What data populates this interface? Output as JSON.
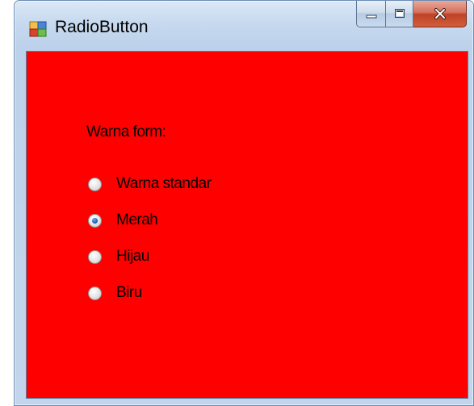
{
  "window": {
    "title": "RadioButton",
    "caption_buttons": {
      "minimize_icon": "minimize-icon",
      "maximize_icon": "maximize-icon",
      "close_icon": "close-icon"
    }
  },
  "form": {
    "background_color": "#ff0000",
    "label": "Warna form:",
    "options": [
      {
        "label": "Warna standar",
        "checked": false
      },
      {
        "label": "Merah",
        "checked": true
      },
      {
        "label": "Hijau",
        "checked": false
      },
      {
        "label": "Biru",
        "checked": false
      }
    ]
  },
  "colors": {
    "client_background": "#ff0000",
    "titlebar": "#c5d8ee",
    "close_button": "#c04226"
  }
}
